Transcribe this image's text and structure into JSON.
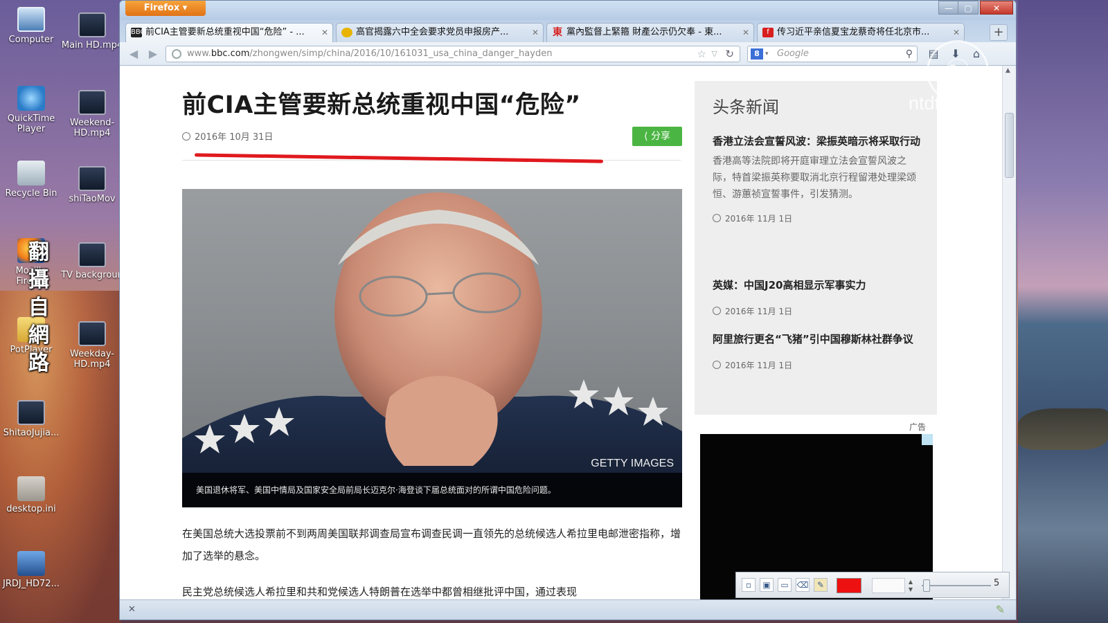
{
  "desktop": {
    "icons": [
      {
        "label": "Computer"
      },
      {
        "label": "Main HD.mp4"
      },
      {
        "label": "QuickTime Player"
      },
      {
        "label": "Weekend-HD.mp4"
      },
      {
        "label": "Recycle Bin"
      },
      {
        "label": "shiTaoMov"
      },
      {
        "label": "Mozilla Firefox"
      },
      {
        "label": "TV backgroun"
      },
      {
        "label": "PotPlayer"
      },
      {
        "label": "Weekday-HD.mp4"
      },
      {
        "label": "ShitaoJujia..."
      },
      {
        "label": "desktop.ini"
      },
      {
        "label": "JRDJ_HD72..."
      }
    ]
  },
  "browser": {
    "app_button": "Firefox ▾",
    "tabs": [
      {
        "title": "前CIA主管要新总统重视中国“危险” - ...",
        "favicon_color": "#222222",
        "favicon_text": "BBC",
        "active": true
      },
      {
        "title": "高官揭露六中全会要求党员申报房产...",
        "favicon_color": "#e8b400",
        "favicon_text": "",
        "active": false
      },
      {
        "title": "黨內監督上緊箍 財產公示仍欠奉 - 東...",
        "favicon_color": "#d81e1e",
        "favicon_text": "東",
        "active": false
      },
      {
        "title": "传习近平亲信夏宝龙蔡奇将任北京市...",
        "favicon_color": "#d81e1e",
        "favicon_text": "f",
        "active": false
      }
    ],
    "url_prefix": "www.",
    "url_host": "bbc.com",
    "url_path": "/zhongwen/simp/china/2016/10/161031_usa_china_danger_hayden",
    "search_placeholder": "Google",
    "search_engine_icon": "8"
  },
  "article": {
    "headline": "前CIA主管要新总统重视中国“危险”",
    "date": "2016年 10月 31日",
    "share_label": "分享",
    "photo_credit": "GETTY IMAGES",
    "caption": "美国退休将军、美国中情局及国家安全局前局长迈克尔·海登谈下届总统面对的所谓中国危险问题。",
    "paragraphs": [
      "在美国总统大选投票前不到两周美国联邦调查局宣布调查民调一直领先的总统候选人希拉里电邮泄密指称，增加了选举的悬念。",
      "民主党总统候选人希拉里和共和党候选人特朗普在选举中都曾相继批评中国，通过表现"
    ]
  },
  "sidebar": {
    "title": "头条新闻",
    "items": [
      {
        "headline": "香港立法会宣誓风波：梁振英暗示将采取行动",
        "summary": "香港高等法院即将开庭审理立法会宣誓风波之际，特首梁振英称要取消北京行程留港处理梁颂恒、游蕙祯宣誓事件，引发猜测。",
        "date": "2016年 11月 1日"
      },
      {
        "headline": "英媒：中国J20高相显示军事实力",
        "summary": "",
        "date": "2016年 11月 1日"
      },
      {
        "headline": "阿里旅行更名“飞猪”引中国穆斯林社群争议",
        "summary": "",
        "date": "2016年 11月 1日"
      }
    ],
    "ad_label": "广告"
  },
  "overlay": {
    "vertical_text": "翻攝自網路",
    "watermark_logo": "☯",
    "watermark": "ntdtv.com"
  },
  "draw_toolbar": {
    "color": "#ee1111",
    "size_value": "5"
  }
}
